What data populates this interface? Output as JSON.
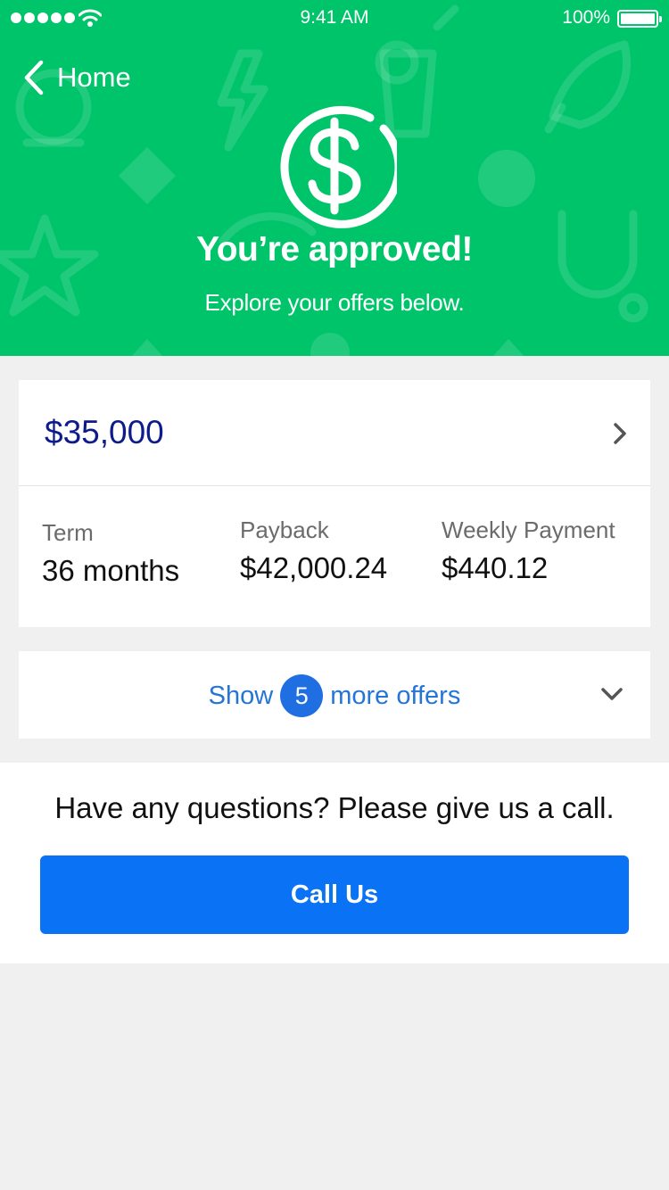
{
  "status_bar": {
    "time": "9:41 AM",
    "battery": "100%"
  },
  "nav": {
    "back_label": "Home",
    "back_icon": "chevron-left-icon"
  },
  "hero": {
    "icon": "dollar-circle-icon",
    "title": "You’re approved!",
    "subtitle": "Explore your offers below."
  },
  "offer": {
    "amount": "$35,000",
    "details": [
      {
        "label": "Term",
        "value": "36 months"
      },
      {
        "label": "Payback",
        "value": "$42,000.24"
      },
      {
        "label": "Weekly Payment",
        "value": "$440.12"
      }
    ]
  },
  "more_offers": {
    "prefix": "Show",
    "count": "5",
    "suffix": "more offers"
  },
  "help": {
    "text": "Have any questions? Please give us a call.",
    "button_label": "Call Us"
  },
  "colors": {
    "hero_green": "#00c46a",
    "amount_navy": "#0d1c8a",
    "link_blue": "#2475d8",
    "button_blue": "#0a73f5",
    "page_gray": "#f0f0f0"
  }
}
